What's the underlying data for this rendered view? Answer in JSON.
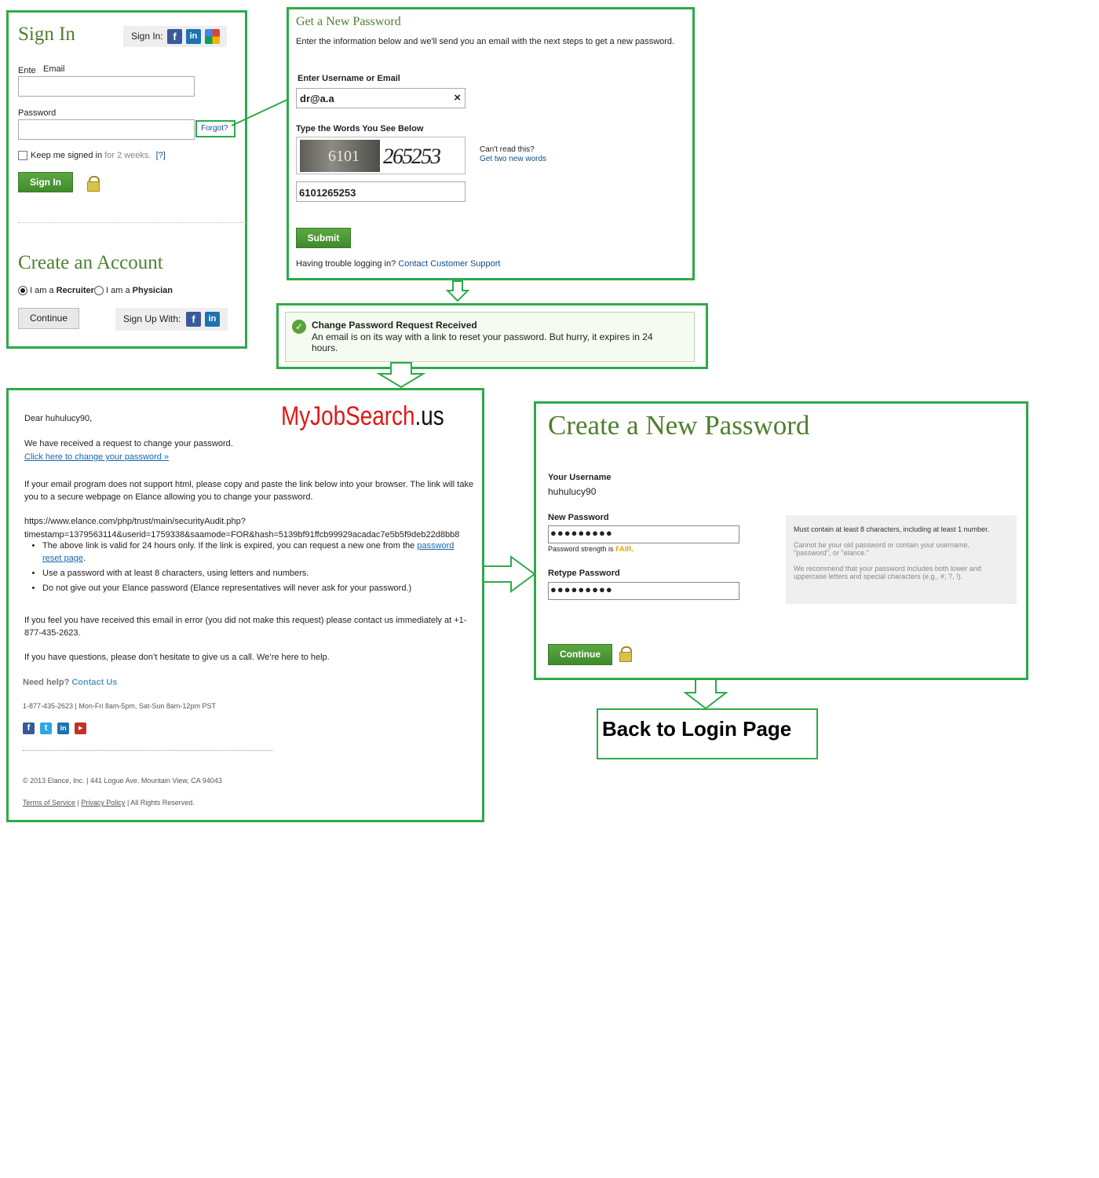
{
  "signin": {
    "title": "Sign In",
    "signin_with": "Sign In:",
    "email_label_partial": "Ente",
    "email_label": "Email",
    "password_label": "Password",
    "forgot": "Forgot?",
    "keep_signed": "Keep me signed in",
    "keep_signed_extra": "for 2 weeks.",
    "help": "[?]",
    "signin_button": "Sign In",
    "create_title": "Create an Account",
    "radio_recruiter_prefix": "I am a",
    "radio_recruiter": "Recruiter",
    "radio_physician_prefix": "I am a",
    "radio_physician": "Physician",
    "continue_button": "Continue",
    "signup_with": "Sign Up With:"
  },
  "new_password": {
    "title": "Get a New Password",
    "description": "Enter the information below and we'll send you an email with the next steps to get a new password.",
    "username_label": "Enter Username or Email",
    "username_value": "dr@a.a",
    "clear": "×",
    "captcha_label": "Type the Words You See Below",
    "captcha_word1": "6101",
    "captcha_word2": "265253",
    "cant_read": "Can't read this?",
    "get_new_words": "Get two new words",
    "captcha_value": "6101265253",
    "submit_button": "Submit",
    "trouble": "Having trouble logging in?",
    "support": "Contact Customer Support"
  },
  "confirmation": {
    "title": "Change Password Request Received",
    "message": "An email is on its way with a link to reset your password. But hurry, it expires in 24 hours."
  },
  "email": {
    "greeting": "Dear huhulucy90,",
    "watermark_a": "MyJobSearch",
    "watermark_b": ".us",
    "p1": "We have received a request to change your password.",
    "change_link": "Click here to change your password »",
    "p2": "If your email program does not support html, please copy and paste the link below into your browser. The link will take you to a secure webpage on Elance allowing you to change your password.",
    "url_line1": "https://www.elance.com/php/trust/main/securityAudit.php?",
    "url_line2": "timestamp=1379563114&userid=1759338&saamode=FOR&hash=5139bf91ffcb99929acadac7e5b5f9deb22d8bb8",
    "bullet1_text": "The above link is valid for 24 hours only. If the link is expired, you can request a new one from the",
    "bullet1_link": "password reset page",
    "bullet1_end": ".",
    "bullet2": "Use a password with at least 8 characters, using letters and numbers.",
    "bullet3": "Do not give out your Elance password (Elance representatives will never ask for your password.)",
    "p3": "If you feel you have received this email in error (you did not make this request) please contact us immediately at +1-877-435-2623.",
    "p4": "If you have questions, please don’t hesitate to give us a call. We’re here to help.",
    "need_help": "Need help?",
    "contact_us": "Contact Us",
    "hours": "1-877-435-2623 | Mon-Fri 8am-5pm, Sat-Sun 8am-12pm PST",
    "copyright": "© 2013 Elance, Inc. | 441 Logue Ave. Mountain View, CA 94043",
    "terms": "Terms of Service",
    "separator1": "|",
    "privacy": "Privacy Policy",
    "rights": "| All Rights Reserved."
  },
  "create_password": {
    "title": "Create a New Password",
    "username_label": "Your Username",
    "username_value": "huhulucy90",
    "new_label": "New Password",
    "new_value": "●●●●●●●●●",
    "strength_prefix": "Password strength is",
    "strength_value": "FAIR",
    "strength_suffix": ".",
    "retype_label": "Retype Password",
    "retype_value": "●●●●●●●●●",
    "hint1": "Must contain at least 8 characters, including at least 1 number.",
    "hint2": "Cannot be your old password or contain your username, \"password\", or \"elance.\"",
    "hint3": "We recommend that your password includes both lower and uppercase letters and special characters (e.g., #, ?, !).",
    "continue_button": "Continue"
  },
  "back": {
    "label": "Back to Login Page"
  },
  "colors": {
    "frame": "#2eaa4a",
    "title_green": "#4f7f2d",
    "button_green": "#4a9a35",
    "fair": "#e0a800"
  }
}
